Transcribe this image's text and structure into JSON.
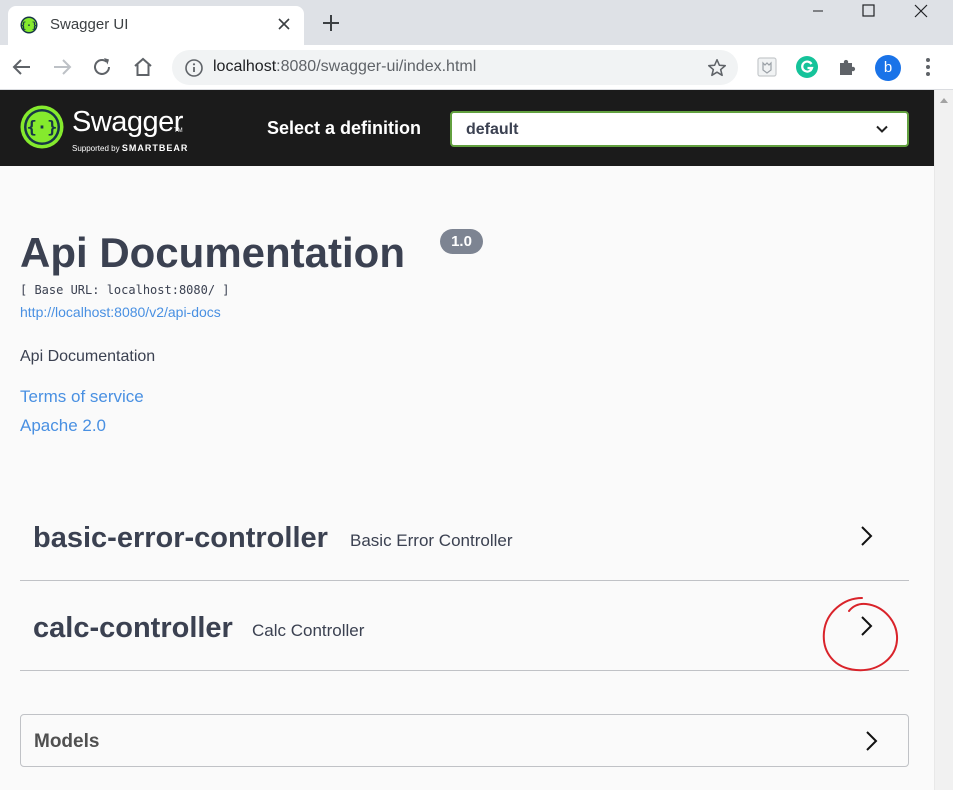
{
  "browser": {
    "tab_title": "Swagger UI",
    "url_host": "localhost",
    "url_path": ":8080/swagger-ui/index.html",
    "avatar_letter": "b",
    "icons": [
      "swagger-favicon-icon",
      "close-icon",
      "plus-icon",
      "minimize-icon",
      "maximize-icon",
      "window-close-icon",
      "back-arrow-icon",
      "forward-arrow-icon",
      "reload-icon",
      "home-icon",
      "info-icon",
      "star-icon",
      "extension-box-icon",
      "grammarly-icon",
      "puzzle-icon",
      "more-vertical-icon"
    ]
  },
  "topbar": {
    "logo_word": "Swagger",
    "logo_tm": "TM",
    "logo_sub_prefix": "Supported by",
    "logo_sub_brand": "SMARTBEAR",
    "definition_label": "Select a definition",
    "definition_value": "default"
  },
  "info": {
    "title": "Api Documentation",
    "version": "1.0",
    "base_url": "[ Base URL: localhost:8080/ ]",
    "docs_link": "http://localhost:8080/v2/api-docs",
    "description": "Api Documentation",
    "terms_link": "Terms of service",
    "license_link": "Apache 2.0"
  },
  "tags": [
    {
      "name": "basic-error-controller",
      "description": "Basic Error Controller"
    },
    {
      "name": "calc-controller",
      "description": "Calc Controller"
    }
  ],
  "models": {
    "label": "Models"
  },
  "colors": {
    "topbar_bg": "#1b1b1b",
    "swagger_green": "#85ea2d",
    "select_border": "#62a03f",
    "link": "#4990e2",
    "text": "#3b4151",
    "annotation_red": "#d9232a"
  }
}
